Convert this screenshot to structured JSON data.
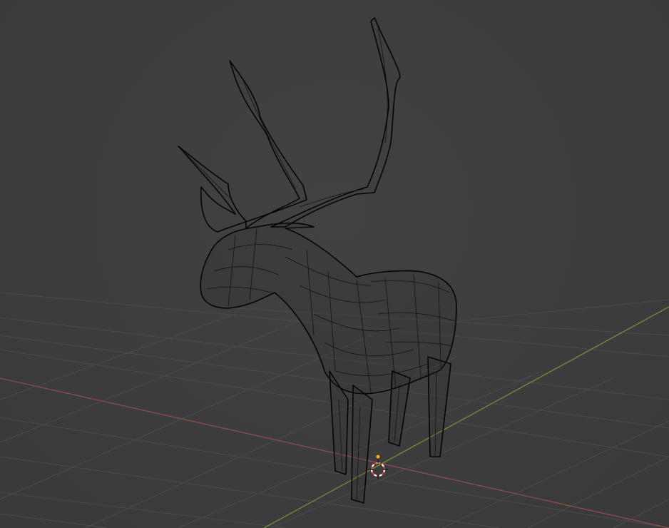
{
  "app": "3D viewport",
  "viewport": {
    "shading_mode": "wireframe",
    "background_color": "#3d3d3d",
    "grid_color": "#4a4a4a",
    "x_axis_color": "#8a4a4e",
    "y_axis_color": "#6e8c3c",
    "wire_color": "#0a0a0a"
  },
  "scene": {
    "object": "reindeer",
    "selected": false
  },
  "cursor": {
    "icon": "3d-cursor-icon",
    "colors": [
      "#ffffff",
      "#d23c3c"
    ]
  },
  "origin": {
    "icon": "object-origin-dot-icon",
    "color": "#f2a23a"
  }
}
